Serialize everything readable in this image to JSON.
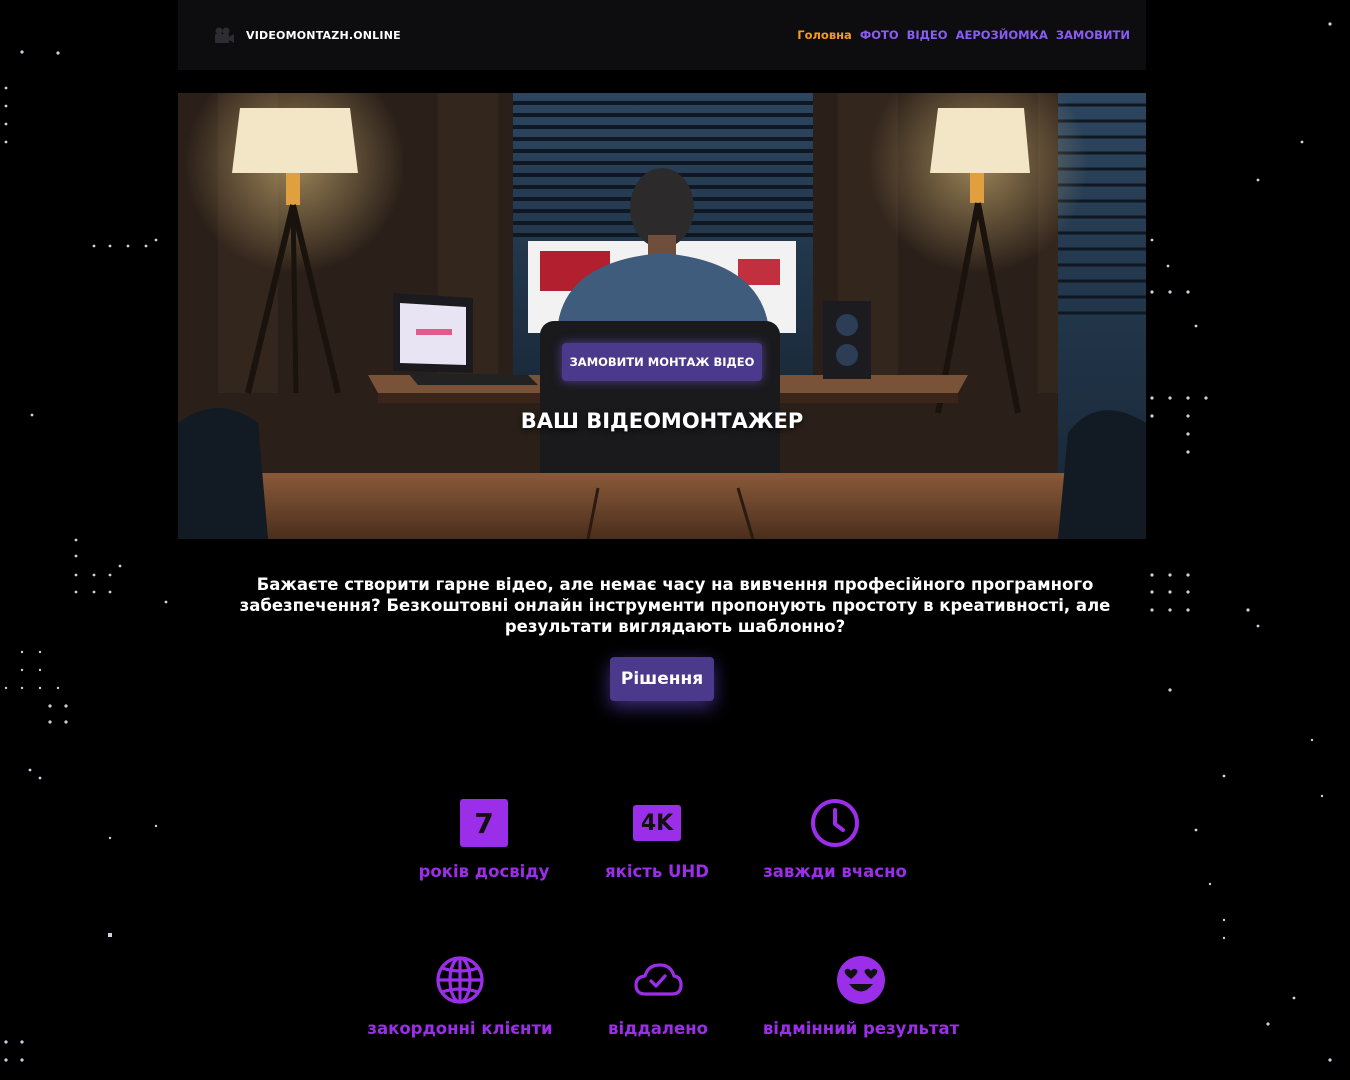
{
  "header": {
    "site_name": "VIDEOMONTAZH.ONLINE",
    "nav": [
      {
        "label": "Головна",
        "active": true
      },
      {
        "label": "ФОТО"
      },
      {
        "label": "ВІДЕО"
      },
      {
        "label": "АЕРОЗЙОМКА"
      },
      {
        "label": "ЗАМОВИТИ"
      }
    ]
  },
  "hero": {
    "cta_label": "ЗАМОВИТИ МОНТАЖ ВІДЕО",
    "title": "ВАШ ВІДЕОМОНТАЖЕР"
  },
  "intro": {
    "text": "Бажаєте створити гарне відео, але немає часу на вивчення професійного програмного забезпечення? Безкоштовні онлайн інструменти пропонують простоту в креативності, але результати виглядають шаблонно?",
    "button_label": "Рішення"
  },
  "features": [
    {
      "icon": "number-7-badge",
      "value": "7",
      "label": "років досвіду"
    },
    {
      "icon": "4k-badge",
      "value": "4K",
      "label": "якість UHD"
    },
    {
      "icon": "clock-icon",
      "label": "завжди вчасно"
    },
    {
      "icon": "globe-icon",
      "label": "закордонні клієнти"
    },
    {
      "icon": "cloud-check-icon",
      "label": "віддалено"
    },
    {
      "icon": "smile-hearts-icon",
      "label": "відмінний результат"
    }
  ],
  "colors": {
    "background": "#000000",
    "accent_purple": "#9b2ee8",
    "button_purple": "#4b3a8c",
    "nav_purple": "#8a5cf5",
    "nav_active": "#f59b20"
  }
}
